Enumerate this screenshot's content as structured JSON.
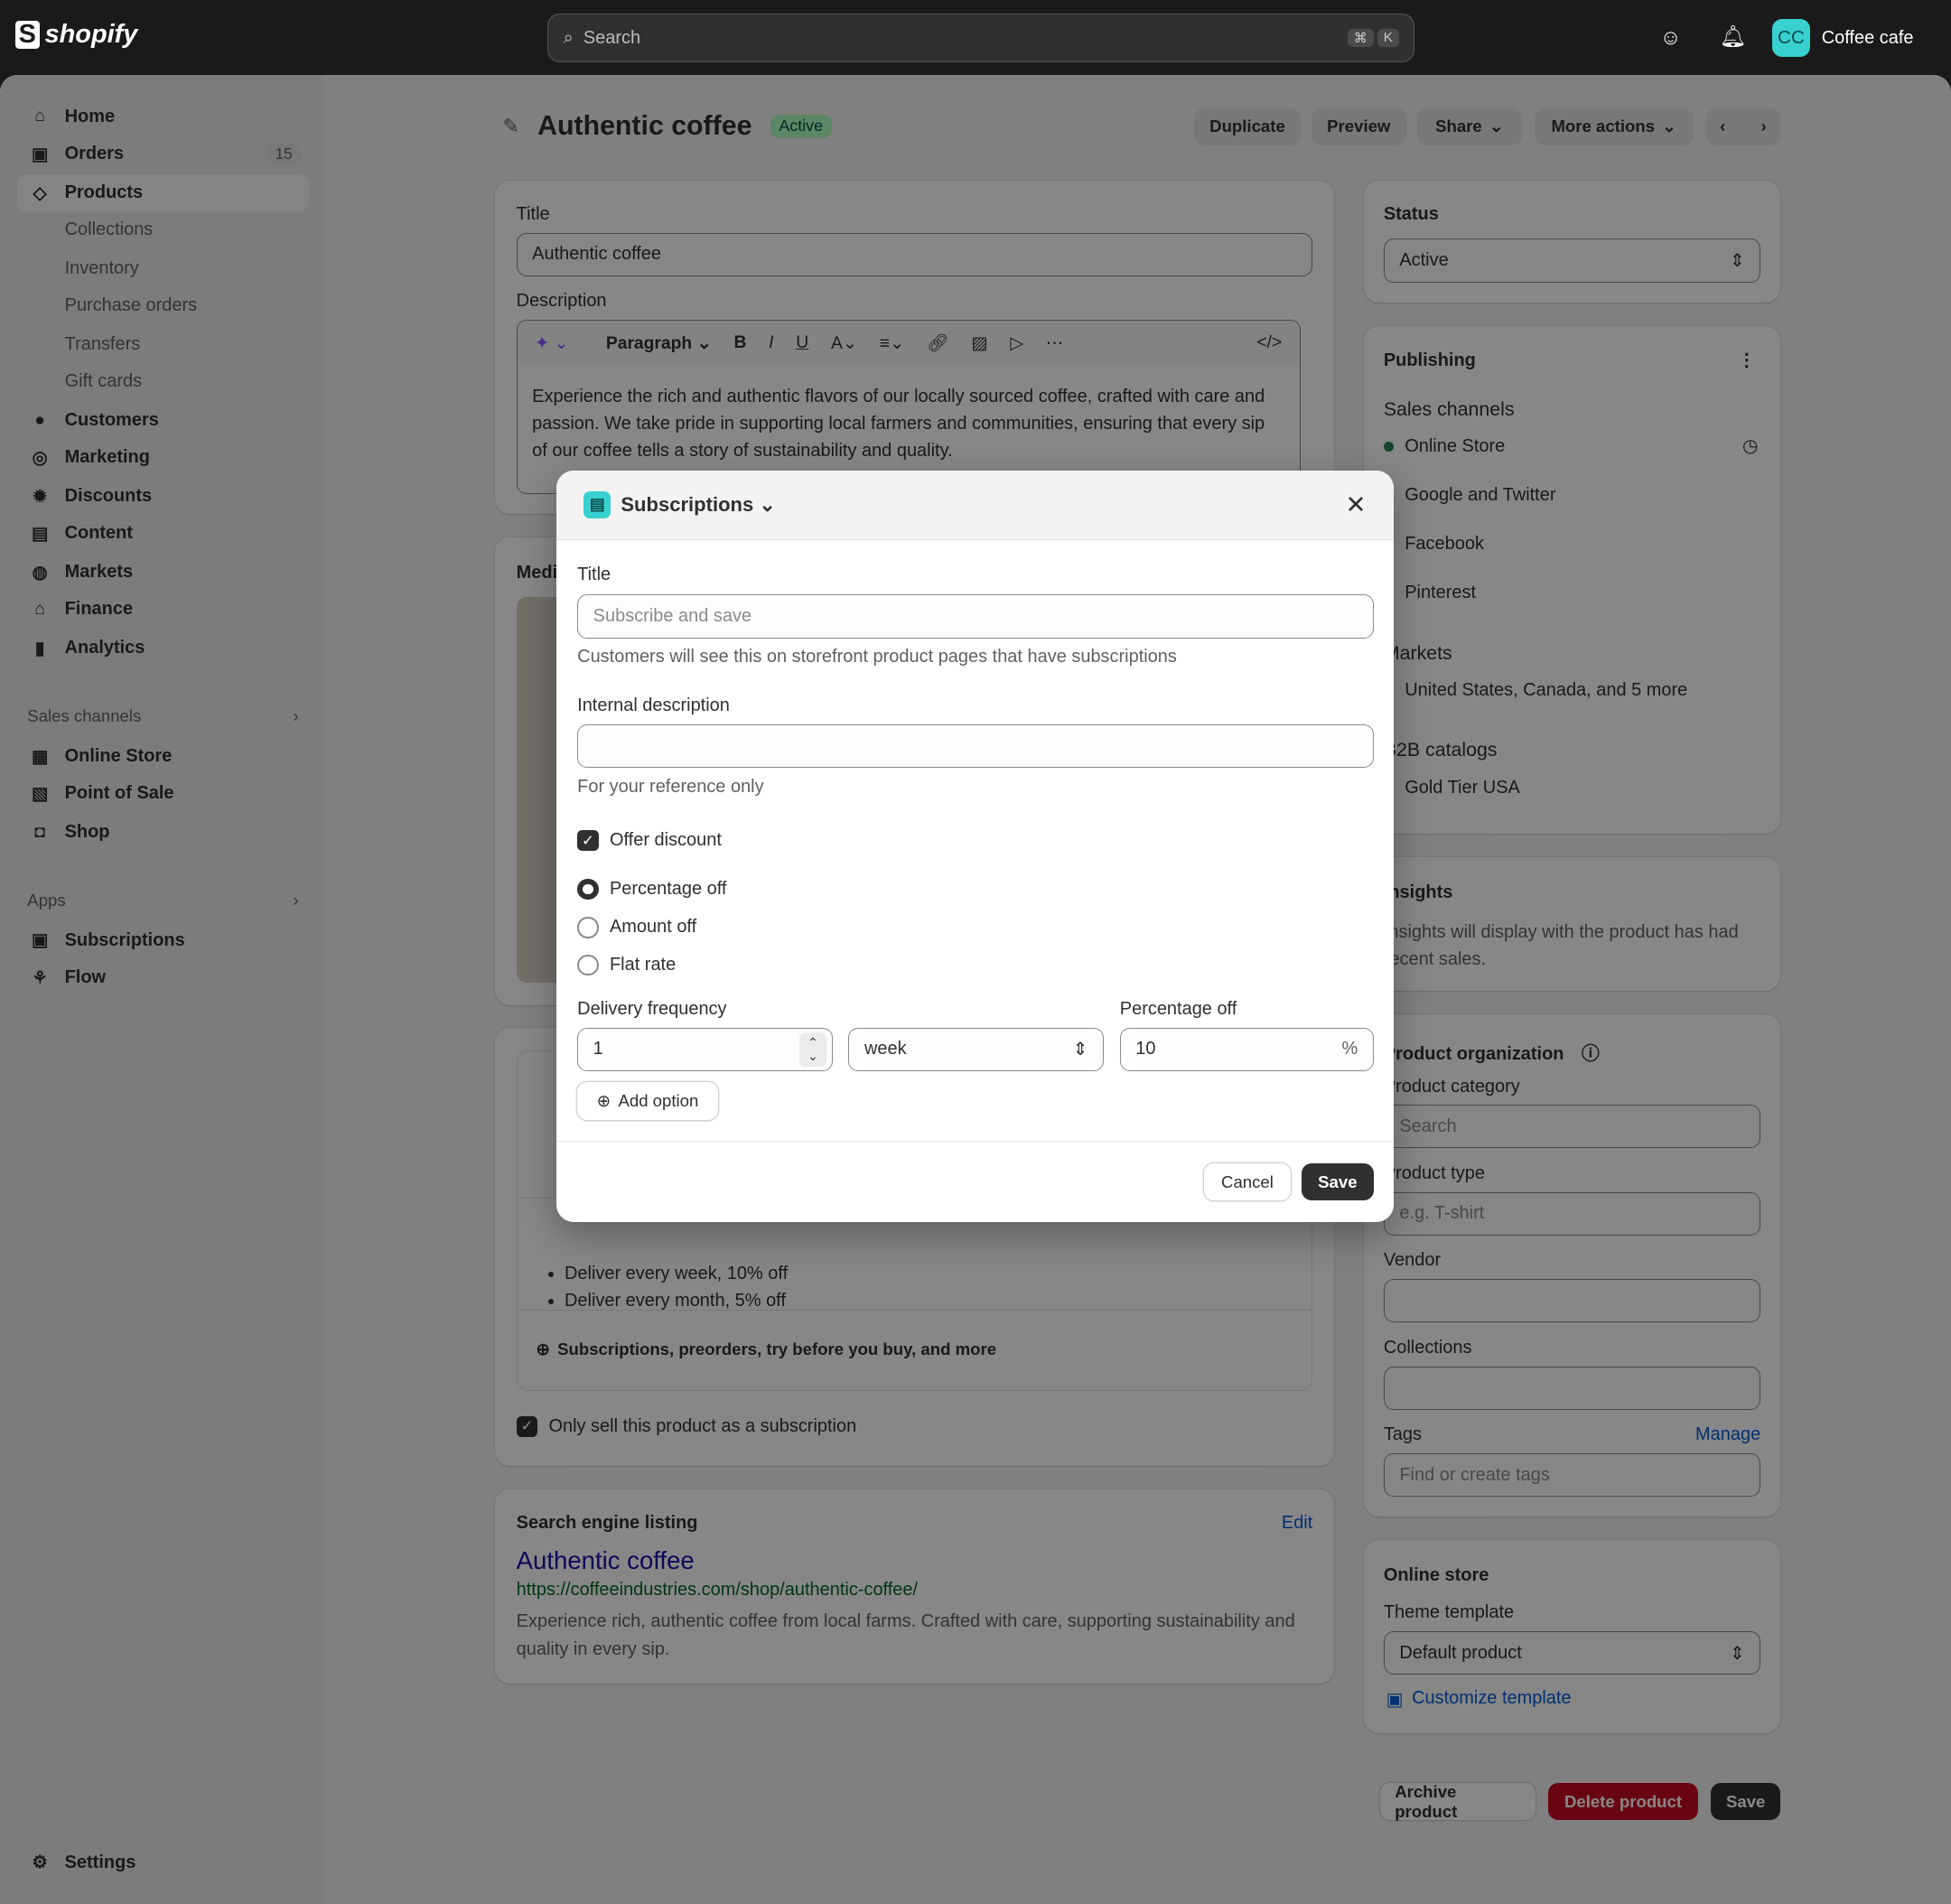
{
  "topbar": {
    "logo": "shopify",
    "search_placeholder": "Search",
    "shortcut": [
      "⌘",
      "K"
    ],
    "store_initials": "CC",
    "store_name": "Coffee cafe"
  },
  "sidebar": {
    "items": [
      {
        "label": "Home",
        "icon": "home-icon"
      },
      {
        "label": "Orders",
        "icon": "inbox-icon",
        "badge": "15"
      },
      {
        "label": "Products",
        "icon": "tag-icon"
      }
    ],
    "product_sub": [
      "Collections",
      "Inventory",
      "Purchase orders",
      "Transfers",
      "Gift cards"
    ],
    "items2": [
      {
        "label": "Customers",
        "icon": "person-icon"
      },
      {
        "label": "Marketing",
        "icon": "target-icon"
      },
      {
        "label": "Discounts",
        "icon": "discount-icon"
      },
      {
        "label": "Content",
        "icon": "image-icon"
      },
      {
        "label": "Markets",
        "icon": "globe-icon"
      },
      {
        "label": "Finance",
        "icon": "bank-icon"
      },
      {
        "label": "Analytics",
        "icon": "chart-icon"
      }
    ],
    "sales_channels_label": "Sales channels",
    "channels": [
      "Online Store",
      "Point of Sale",
      "Shop"
    ],
    "apps_label": "Apps",
    "apps": [
      "Subscriptions",
      "Flow"
    ],
    "settings": "Settings"
  },
  "header": {
    "title": "Authentic coffee",
    "status": "Active",
    "buttons": [
      "Duplicate",
      "Preview",
      "Share",
      "More actions"
    ]
  },
  "product": {
    "title_label": "Title",
    "title_value": "Authentic coffee",
    "description_label": "Description",
    "paragraph": "Paragraph",
    "description": "Experience the rich and authentic flavors of our locally sourced coffee, crafted with care and passion. We take pride in supporting local farmers and communities, ensuring that every sip of our coffee tells a story of sustainability and quality.",
    "media_label": "Media"
  },
  "subs_card": {
    "bullets": [
      "Deliver every week, 10% off",
      "Deliver every month, 5% off"
    ],
    "more": "Subscriptions, preorders, try before you buy, and more",
    "only_sub": "Only sell this product as a subscription"
  },
  "seo": {
    "heading": "Search engine listing",
    "edit": "Edit",
    "title": "Authentic coffee",
    "url": "https://coffeeindustries.com/shop/authentic-coffee/",
    "desc": "Experience rich, authentic coffee from local farms. Crafted with care, supporting sustainability and quality in every sip."
  },
  "status": {
    "heading": "Status",
    "value": "Active"
  },
  "publishing": {
    "heading": "Publishing",
    "sales_channels": "Sales channels",
    "channels": [
      "Online Store",
      "Google and Twitter",
      "Facebook",
      "Pinterest"
    ],
    "markets_label": "Markets",
    "markets": "United States, Canada, and 5 more",
    "b2b_label": "B2B catalogs",
    "b2b": "Gold Tier USA"
  },
  "insights": {
    "heading": "Insights",
    "text": "Insights will display with the product has had recent sales."
  },
  "org": {
    "heading": "Product organization",
    "category_label": "Product category",
    "category_ph": "Search",
    "type_label": "Product type",
    "type_ph": "e.g. T-shirt",
    "vendor_label": "Vendor",
    "collections_label": "Collections",
    "tags_label": "Tags",
    "manage": "Manage",
    "tags_ph": "Find or create tags"
  },
  "online_store": {
    "heading": "Online store",
    "theme_label": "Theme template",
    "theme_value": "Default product",
    "customize": "Customize template"
  },
  "footer": {
    "archive": "Archive product",
    "delete": "Delete product",
    "save": "Save"
  },
  "modal": {
    "app": "Subscriptions",
    "title_label": "Title",
    "title_ph": "Subscribe and save",
    "title_help": "Customers will see this on storefront product pages that have subscriptions",
    "internal_label": "Internal description",
    "internal_help": "For your reference only",
    "offer_discount": "Offer discount",
    "options": [
      "Percentage off",
      "Amount off",
      "Flat rate"
    ],
    "selected_option": "Percentage off",
    "freq_label": "Delivery frequency",
    "freq_value": "1",
    "freq_unit": "week",
    "pct_label": "Percentage off",
    "pct_value": "10",
    "pct_suffix": "%",
    "add_option": "Add option",
    "cancel": "Cancel",
    "save": "Save"
  },
  "colors": {
    "accent_teal": "#38d1cf",
    "active_green": "#affebf",
    "delete_red": "#c70a24",
    "link_blue": "#005bd3"
  }
}
